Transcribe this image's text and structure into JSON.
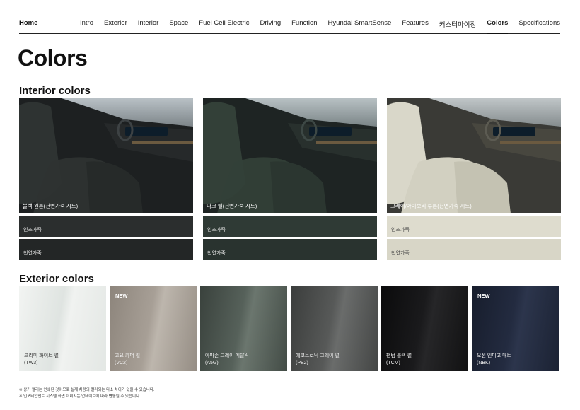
{
  "nav": {
    "home": "Home",
    "items": [
      "Intro",
      "Exterior",
      "Interior",
      "Space",
      "Fuel Cell Electric",
      "Driving",
      "Function",
      "Hyundai SmartSense",
      "Features",
      "커스터마이징",
      "Colors",
      "Specifications"
    ],
    "active": "Colors"
  },
  "page_title": "Colors",
  "interior": {
    "title": "Interior colors",
    "options": [
      {
        "caption": "블랙 원톤(천연가죽 시트)",
        "swatch1": "인조가죽",
        "swatch2": "천연가죽",
        "seat": "#2e3332",
        "swatch_color1": "#2b2e2e",
        "swatch_color2": "#232626"
      },
      {
        "caption": "다크 틸(천연가죽 시트)",
        "swatch1": "인조가죽",
        "swatch2": "천연가죽",
        "seat": "#334038",
        "swatch_color1": "#2f3a35",
        "swatch_color2": "#29332f"
      },
      {
        "caption": "그레이/아이보리 투톤(천연가죽 시트)",
        "swatch1": "인조가죽",
        "swatch2": "천연가죽",
        "seat": "#d9d7c9",
        "swatch_color1": "#dedcce",
        "swatch_color2": "#d8d6c7"
      }
    ]
  },
  "exterior": {
    "title": "Exterior colors",
    "options": [
      {
        "badge": "",
        "name": "크리미 화이트 펄",
        "code": "(TW3)",
        "color": "#e8ebe9",
        "tone": "light"
      },
      {
        "badge": "NEW",
        "name": "고요 카퍼 펄",
        "code": "(VC2)",
        "color": "#9c948b",
        "tone": "dark"
      },
      {
        "badge": "",
        "name": "아마존 그레이 메탈릭",
        "code": "(A5G)",
        "color": "#4c5650",
        "tone": "dark"
      },
      {
        "badge": "",
        "name": "에코트로닉 그레이 펄",
        "code": "(PE2)",
        "color": "#4d4f4e",
        "tone": "dark"
      },
      {
        "badge": "",
        "name": "팬텀 블랙 펄",
        "code": "(TCM)",
        "color": "#141415",
        "tone": "dark"
      },
      {
        "badge": "NEW",
        "name": "오션 인디고 매트",
        "code": "(NBK)",
        "color": "#1f2638",
        "tone": "dark"
      }
    ]
  },
  "notes": [
    "※ 상기 컬러는 인쇄된 것이므로 실제 차량의 컬러와는 다소 차이가 있을 수 있습니다.",
    "※ 인포테인먼트 시스템 화면 이미지는 업데이트에 따라 변동될 수 있습니다."
  ]
}
